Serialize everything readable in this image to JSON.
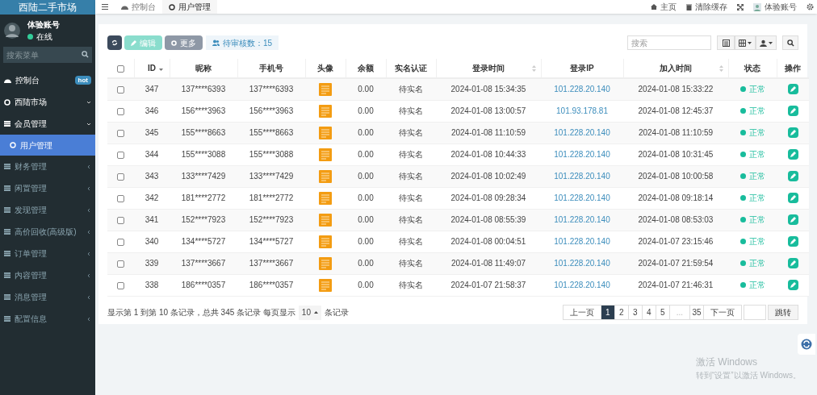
{
  "sidebar": {
    "brand": "西陆二手市场",
    "user": {
      "name": "体验账号",
      "status": "在线",
      "online": true
    },
    "search": {
      "placeholder": "搜索菜单"
    },
    "items": [
      {
        "kind": "dashboard",
        "label": "控制台",
        "badge": "hot"
      },
      {
        "kind": "module",
        "label": "西陆市场",
        "expanded": true
      },
      {
        "kind": "menu",
        "label": "会员管理",
        "expanded": true,
        "children": [
          {
            "label": "用户管理",
            "selected": true
          }
        ]
      },
      {
        "kind": "menu",
        "label": "财务管理",
        "expanded": false
      },
      {
        "kind": "menu",
        "label": "闲置管理",
        "expanded": false
      },
      {
        "kind": "menu",
        "label": "发现管理",
        "expanded": false
      },
      {
        "kind": "menu",
        "label": "高价回收(高级版)",
        "expanded": false
      },
      {
        "kind": "menu",
        "label": "订单管理",
        "expanded": false
      },
      {
        "kind": "menu",
        "label": "内容管理",
        "expanded": false
      },
      {
        "kind": "menu",
        "label": "消息管理",
        "expanded": false
      },
      {
        "kind": "menu",
        "label": "配置信息",
        "expanded": false
      }
    ]
  },
  "topbar": {
    "tabs": [
      {
        "kind": "dashboard",
        "label": "控制台",
        "selected": false
      },
      {
        "kind": "page",
        "label": "用户管理",
        "selected": true
      }
    ],
    "links": [
      {
        "kind": "home",
        "label": "主页"
      },
      {
        "kind": "trash",
        "label": "清除缓存"
      },
      {
        "kind": "fullscreen"
      },
      {
        "kind": "user",
        "label": "体验账号"
      },
      {
        "kind": "settings"
      }
    ]
  },
  "toolbar": {
    "buttons": [
      {
        "kind": "refresh",
        "disabled": false
      },
      {
        "kind": "edit",
        "label": "编辑",
        "disabled": true
      },
      {
        "kind": "more",
        "label": "更多",
        "disabled": false
      }
    ],
    "pending": "待审核数：15",
    "search": {
      "placeholder": "搜索"
    }
  },
  "table": {
    "columns": [
      {
        "kind": "check",
        "checked": false
      },
      {
        "label": "ID",
        "sortable": true,
        "sorted": true
      },
      {
        "label": "昵称"
      },
      {
        "label": "手机号"
      },
      {
        "label": "头像"
      },
      {
        "label": "余额"
      },
      {
        "label": "实名认证"
      },
      {
        "label": "登录时间",
        "sortable": true,
        "sorted": false
      },
      {
        "label": "登录IP"
      },
      {
        "label": "加入时间",
        "sortable": true,
        "sorted": false
      },
      {
        "label": "状态"
      },
      {
        "label": "操作"
      }
    ],
    "rows": [
      {
        "selected": false,
        "id": "347",
        "nickname": "137****6393",
        "phone": "137****6393",
        "balance": "0.00",
        "verification": "待实名",
        "login_time": "2024-01-08 15:34:35",
        "login_ip": "101.228.20.140",
        "join_time": "2024-01-08 15:33:22",
        "status": "正常",
        "enabled": true
      },
      {
        "selected": false,
        "id": "346",
        "nickname": "156****3963",
        "phone": "156****3963",
        "balance": "0.00",
        "verification": "待实名",
        "login_time": "2024-01-08 13:00:57",
        "login_ip": "101.93.178.81",
        "join_time": "2024-01-08 12:45:37",
        "status": "正常",
        "enabled": true
      },
      {
        "selected": false,
        "id": "345",
        "nickname": "155****8663",
        "phone": "155****8663",
        "balance": "0.00",
        "verification": "待实名",
        "login_time": "2024-01-08 11:10:59",
        "login_ip": "101.228.20.140",
        "join_time": "2024-01-08 11:10:59",
        "status": "正常",
        "enabled": true
      },
      {
        "selected": false,
        "id": "344",
        "nickname": "155****3088",
        "phone": "155****3088",
        "balance": "0.00",
        "verification": "待实名",
        "login_time": "2024-01-08 10:44:33",
        "login_ip": "101.228.20.140",
        "join_time": "2024-01-08 10:31:45",
        "status": "正常",
        "enabled": true
      },
      {
        "selected": false,
        "id": "343",
        "nickname": "133****7429",
        "phone": "133****7429",
        "balance": "0.00",
        "verification": "待实名",
        "login_time": "2024-01-08 10:02:49",
        "login_ip": "101.228.20.140",
        "join_time": "2024-01-08 10:00:58",
        "status": "正常",
        "enabled": true
      },
      {
        "selected": false,
        "id": "342",
        "nickname": "181****2772",
        "phone": "181****2772",
        "balance": "0.00",
        "verification": "待实名",
        "login_time": "2024-01-08 09:28:34",
        "login_ip": "101.228.20.140",
        "join_time": "2024-01-08 09:18:14",
        "status": "正常",
        "enabled": true
      },
      {
        "selected": false,
        "id": "341",
        "nickname": "152****7923",
        "phone": "152****7923",
        "balance": "0.00",
        "verification": "待实名",
        "login_time": "2024-01-08 08:55:39",
        "login_ip": "101.228.20.140",
        "join_time": "2024-01-08 08:53:03",
        "status": "正常",
        "enabled": true
      },
      {
        "selected": false,
        "id": "340",
        "nickname": "134****5727",
        "phone": "134****5727",
        "balance": "0.00",
        "verification": "待实名",
        "login_time": "2024-01-08 00:04:51",
        "login_ip": "101.228.20.140",
        "join_time": "2024-01-07 23:15:46",
        "status": "正常",
        "enabled": true
      },
      {
        "selected": false,
        "id": "339",
        "nickname": "137****3667",
        "phone": "137****3667",
        "balance": "0.00",
        "verification": "待实名",
        "login_time": "2024-01-08 11:49:07",
        "login_ip": "101.228.20.140",
        "join_time": "2024-01-07 21:59:54",
        "status": "正常",
        "enabled": true
      },
      {
        "selected": false,
        "id": "338",
        "nickname": "186****0357",
        "phone": "186****0357",
        "balance": "0.00",
        "verification": "待实名",
        "login_time": "2024-01-07 21:58:37",
        "login_ip": "101.228.20.140",
        "join_time": "2024-01-07 21:46:31",
        "status": "正常",
        "enabled": true
      }
    ]
  },
  "footer": {
    "summary": "显示第 1 到第 10 条记录，总共 345 条记录 每页显示",
    "page_size": "10",
    "unit": "条记录"
  },
  "pagination": [
    {
      "kind": "prev",
      "label": "上一页",
      "selected": false
    },
    {
      "kind": "page",
      "label": "1",
      "selected": true
    },
    {
      "kind": "page",
      "label": "2",
      "selected": false
    },
    {
      "kind": "page",
      "label": "3",
      "selected": false
    },
    {
      "kind": "page",
      "label": "4",
      "selected": false
    },
    {
      "kind": "page",
      "label": "5",
      "selected": false
    },
    {
      "kind": "gap",
      "label": "...",
      "selected": false
    },
    {
      "kind": "page",
      "label": "35",
      "selected": false
    },
    {
      "kind": "next",
      "label": "下一页",
      "selected": false
    }
  ],
  "jump": {
    "label": "跳转"
  },
  "activation": {
    "title": "激活 Windows",
    "hint": "转到“设置”以激活 Windows。"
  }
}
